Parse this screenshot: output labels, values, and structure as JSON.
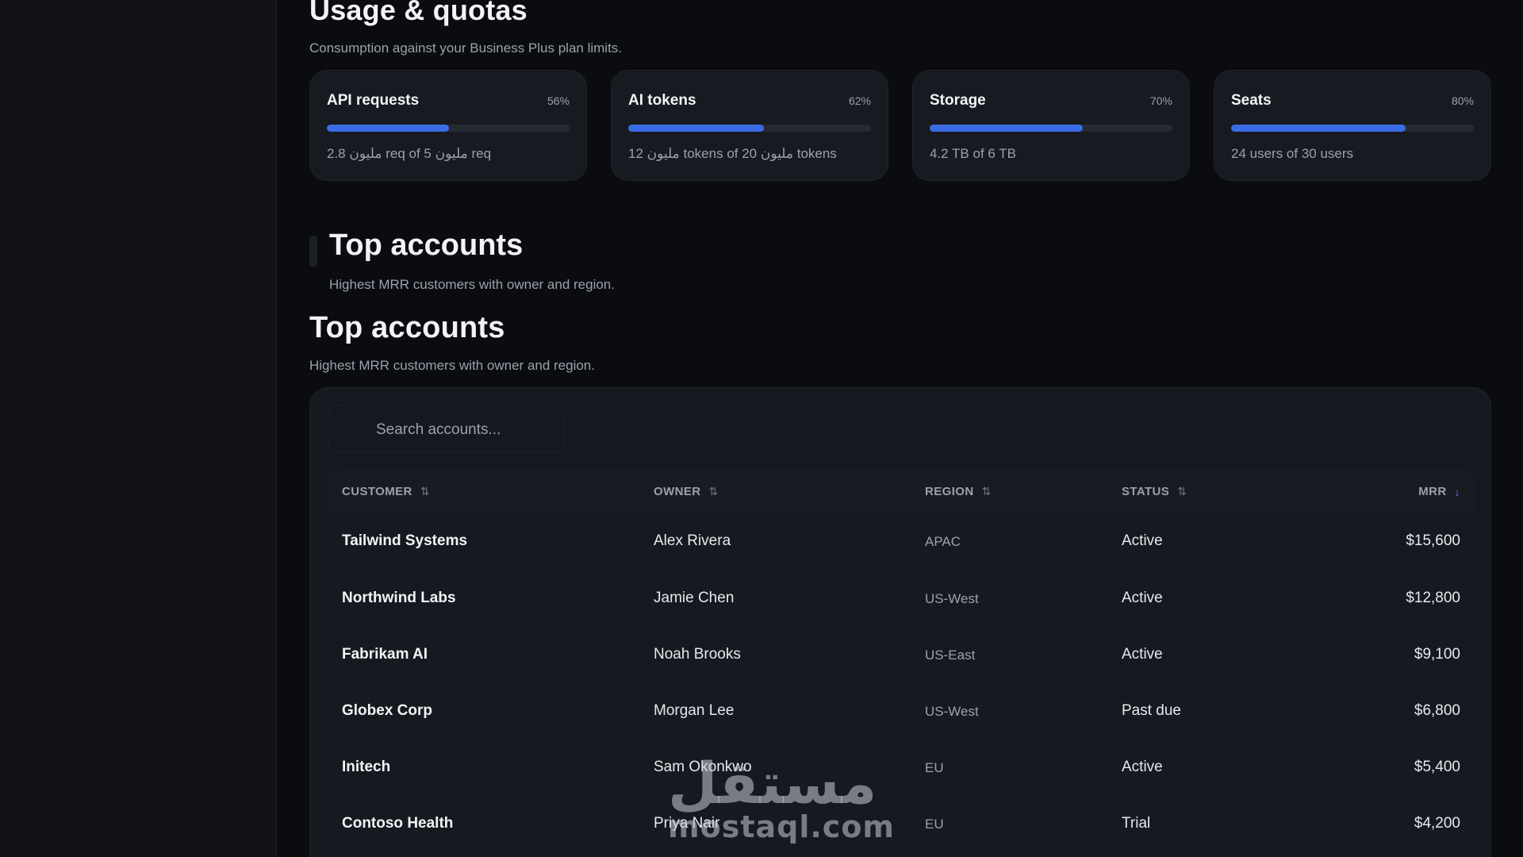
{
  "usage": {
    "title": "Usage & quotas",
    "subtitle": "Consumption against your Business Plus plan limits.",
    "cards": [
      {
        "title": "API requests",
        "percent_label": "56%",
        "percent": 56,
        "detail": "2.8 مليون req of 5 مليون req"
      },
      {
        "title": "AI tokens",
        "percent_label": "62%",
        "percent": 62,
        "detail": "12 مليون tokens of 20 مليون tokens"
      },
      {
        "title": "Storage",
        "percent_label": "70%",
        "percent": 70,
        "detail": "4.2 TB of 6 TB"
      },
      {
        "title": "Seats",
        "percent_label": "80%",
        "percent": 80,
        "detail": "24 users of 30 users"
      }
    ],
    "accent_color": "#3b6ce6"
  },
  "ghost_section": {
    "title": "Top accounts",
    "subtitle": "Highest MRR customers with owner and region."
  },
  "accounts": {
    "title": "Top accounts",
    "subtitle": "Highest MRR customers with owner and region.",
    "search": {
      "placeholder": "Search accounts...",
      "icon": "search-icon"
    },
    "columns": {
      "customer": "CUSTOMER",
      "owner": "OWNER",
      "region": "REGION",
      "status": "STATUS",
      "mrr": "MRR"
    },
    "sort": {
      "inactive_icon": "⇅",
      "active_icon": "↓",
      "active_column": "mrr",
      "active_color": "#4f7ef0"
    },
    "rows": [
      {
        "customer": "Tailwind Systems",
        "owner": "Alex Rivera",
        "region": "APAC",
        "status": "Active",
        "mrr": "$15,600"
      },
      {
        "customer": "Northwind Labs",
        "owner": "Jamie Chen",
        "region": "US-West",
        "status": "Active",
        "mrr": "$12,800"
      },
      {
        "customer": "Fabrikam AI",
        "owner": "Noah Brooks",
        "region": "US-East",
        "status": "Active",
        "mrr": "$9,100"
      },
      {
        "customer": "Globex Corp",
        "owner": "Morgan Lee",
        "region": "US-West",
        "status": "Past due",
        "mrr": "$6,800"
      },
      {
        "customer": "Initech",
        "owner": "Sam Okonkwo",
        "region": "EU",
        "status": "Active",
        "mrr": "$5,400"
      },
      {
        "customer": "Contoso Health",
        "owner": "Priya Nair",
        "region": "EU",
        "status": "Trial",
        "mrr": "$4,200"
      }
    ]
  },
  "watermark": {
    "arabic": "مستقل",
    "latin": "mostaql.com"
  }
}
